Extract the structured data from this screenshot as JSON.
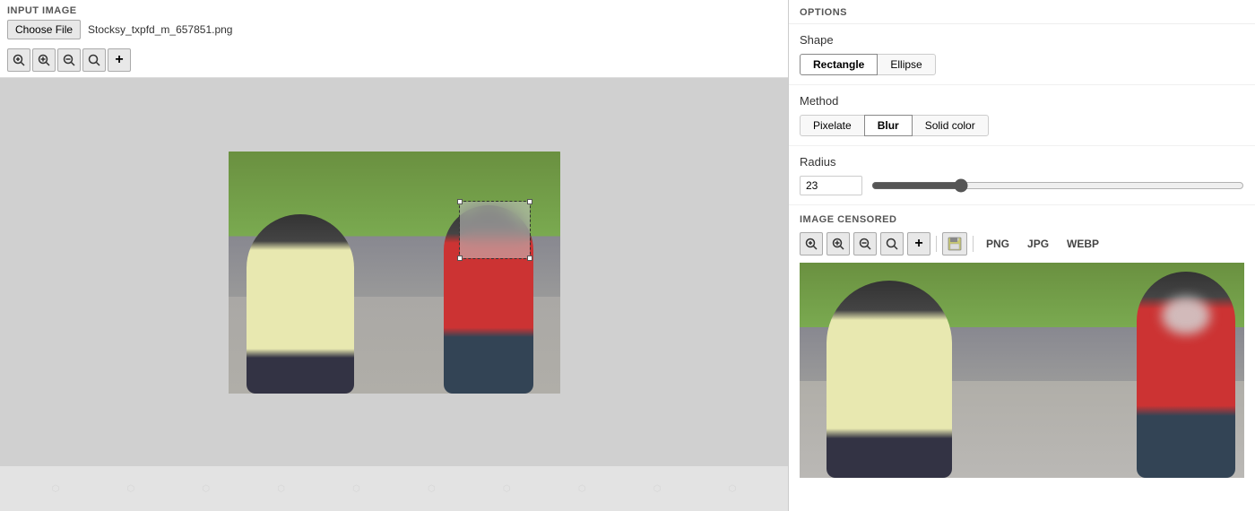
{
  "left": {
    "section_label": "INPUT IMAGE",
    "choose_file_label": "Choose File",
    "file_name": "Stocksy_txpfd_m_657851.png",
    "zoom_buttons": [
      {
        "id": "zoom-fit",
        "symbol": "⊕",
        "title": "Zoom fit"
      },
      {
        "id": "zoom-in",
        "symbol": "⊕",
        "title": "Zoom in"
      },
      {
        "id": "zoom-out",
        "symbol": "⊖",
        "title": "Zoom out"
      },
      {
        "id": "zoom-reset",
        "symbol": "⊙",
        "title": "Zoom reset"
      },
      {
        "id": "zoom-add",
        "symbol": "✚",
        "title": "Add region"
      }
    ]
  },
  "right": {
    "options_title": "OPTIONS",
    "shape_label": "Shape",
    "shape_options": [
      {
        "label": "Rectangle",
        "active": true
      },
      {
        "label": "Ellipse",
        "active": false
      }
    ],
    "method_label": "Method",
    "method_options": [
      {
        "label": "Pixelate",
        "active": false
      },
      {
        "label": "Blur",
        "active": true
      },
      {
        "label": "Solid color",
        "active": false
      }
    ],
    "radius_label": "Radius",
    "radius_value": "23",
    "radius_min": 0,
    "radius_max": 100,
    "radius_current": 23,
    "image_censored_label": "IMAGE CENSORED",
    "export_formats": [
      "PNG",
      "JPG",
      "WEBP"
    ],
    "save_icon": "💾"
  }
}
